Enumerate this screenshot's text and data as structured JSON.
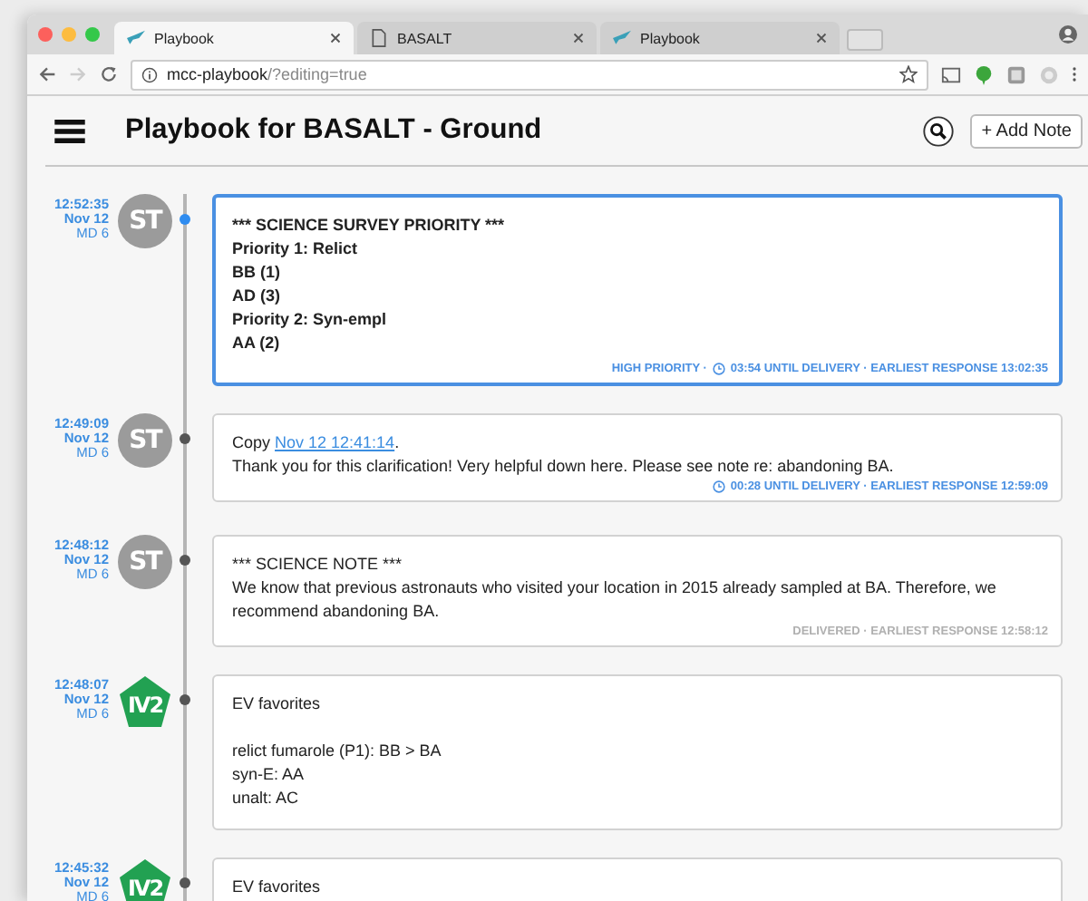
{
  "browser": {
    "tabs": [
      {
        "title": "Playbook",
        "kind": "bird",
        "selected": true
      },
      {
        "title": "BASALT",
        "kind": "page",
        "selected": false
      },
      {
        "title": "Playbook",
        "kind": "bird",
        "selected": false
      }
    ],
    "address": {
      "host": "mcc-playbook",
      "path": "/?editing=true"
    }
  },
  "app": {
    "title": "Playbook for BASALT - Ground",
    "add_button": "+ Add Note"
  },
  "notes": [
    {
      "time": "12:52:35",
      "date": "Nov 12",
      "md": "MD 6",
      "author": {
        "kind": "circle",
        "initials": "ST"
      },
      "selected": true,
      "bold": true,
      "paragraphs": [
        [
          "*** SCIENCE SURVEY PRIORITY ***",
          "Priority 1: Relict",
          "BB (1)",
          "AD (3)",
          "Priority 2: Syn-empl",
          "AA (2)"
        ]
      ],
      "footer": {
        "kind": "pending",
        "segments": [
          {
            "text": "HIGH PRIORITY ·",
            "clock": false
          },
          {
            "text": "03:54 UNTIL DELIVERY · EARLIEST RESPONSE 13:02:35",
            "clock": true
          }
        ]
      }
    },
    {
      "time": "12:49:09",
      "date": "Nov 12",
      "md": "MD 6",
      "author": {
        "kind": "circle",
        "initials": "ST"
      },
      "selected": false,
      "bold": false,
      "paragraphs": [
        [
          {
            "before": "Copy ",
            "link": "Nov 12 12:41:14",
            "after": "."
          },
          "Thank you for this clarification! Very helpful down here. Please see note re: abandoning BA."
        ]
      ],
      "footer": {
        "kind": "pending",
        "segments": [
          {
            "text": "00:28 UNTIL DELIVERY · EARLIEST RESPONSE 12:59:09",
            "clock": true
          }
        ]
      }
    },
    {
      "time": "12:48:12",
      "date": "Nov 12",
      "md": "MD 6",
      "author": {
        "kind": "circle",
        "initials": "ST"
      },
      "selected": false,
      "bold": false,
      "paragraphs": [
        [
          "*** SCIENCE NOTE ***",
          "We know that previous astronauts who visited your location in 2015 already sampled at BA. Therefore, we recommend abandoning BA."
        ]
      ],
      "footer": {
        "kind": "delivered",
        "segments": [
          {
            "text": "DELIVERED · EARLIEST RESPONSE 12:58:12",
            "clock": false
          }
        ]
      }
    },
    {
      "time": "12:48:07",
      "date": "Nov 12",
      "md": "MD 6",
      "author": {
        "kind": "pentagon",
        "initials": "IV2"
      },
      "selected": false,
      "bold": false,
      "paragraphs": [
        [
          "EV favorites"
        ],
        [
          "relict fumarole (P1): BB > BA",
          "syn-E: AA",
          "unalt: AC"
        ]
      ]
    },
    {
      "time": "12:45:32",
      "date": "Nov 12",
      "md": "MD 6",
      "author": {
        "kind": "pentagon",
        "initials": "IV2"
      },
      "selected": false,
      "bold": false,
      "paragraphs": [
        [
          "EV favorites"
        ]
      ]
    }
  ]
}
